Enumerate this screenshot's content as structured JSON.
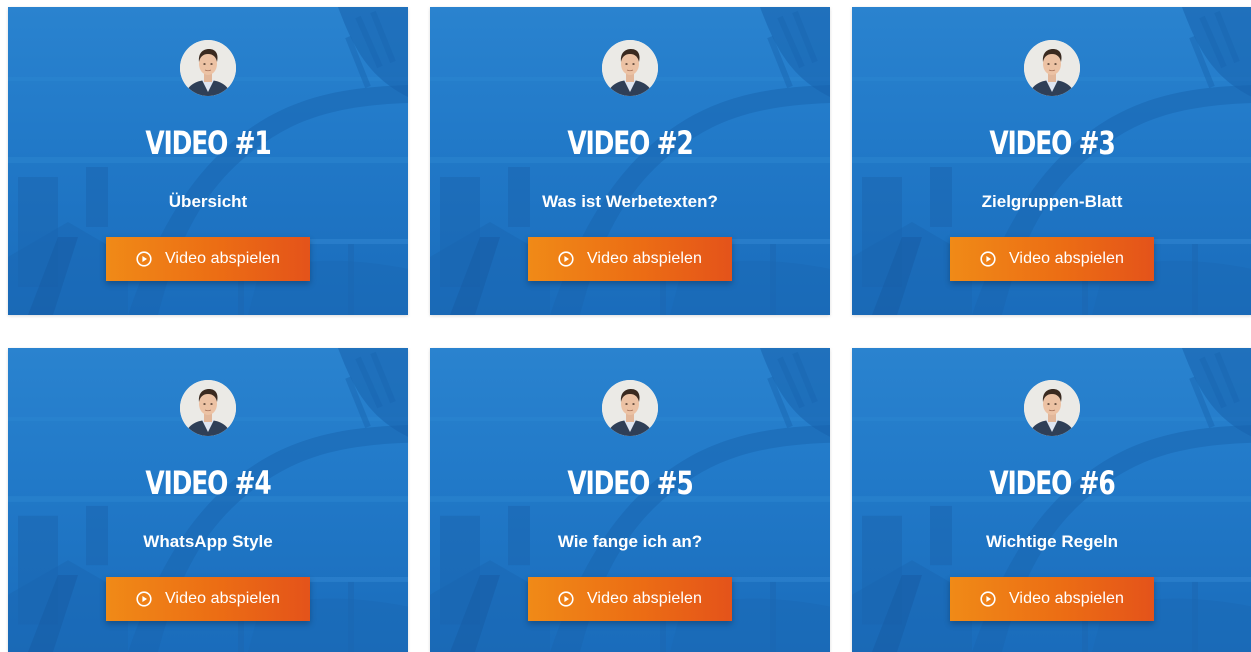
{
  "colors": {
    "card_blue": "#1f78c8",
    "button_orange_start": "#f08a17",
    "button_orange_end": "#e4531a",
    "text": "#ffffff"
  },
  "icons": {
    "avatar": "presenter-avatar",
    "play": "play-circle-icon"
  },
  "cards": [
    {
      "title": "VIDEO #1",
      "subtitle": "Übersicht",
      "button_label": "Video abspielen"
    },
    {
      "title": "VIDEO #2",
      "subtitle": "Was ist Werbetexten?",
      "button_label": "Video abspielen"
    },
    {
      "title": "VIDEO #3",
      "subtitle": "Zielgruppen-Blatt",
      "button_label": "Video abspielen"
    },
    {
      "title": "VIDEO #4",
      "subtitle": "WhatsApp Style",
      "button_label": "Video abspielen"
    },
    {
      "title": "VIDEO #5",
      "subtitle": "Wie fange ich an?",
      "button_label": "Video abspielen"
    },
    {
      "title": "VIDEO #6",
      "subtitle": "Wichtige Regeln",
      "button_label": "Video abspielen"
    }
  ]
}
